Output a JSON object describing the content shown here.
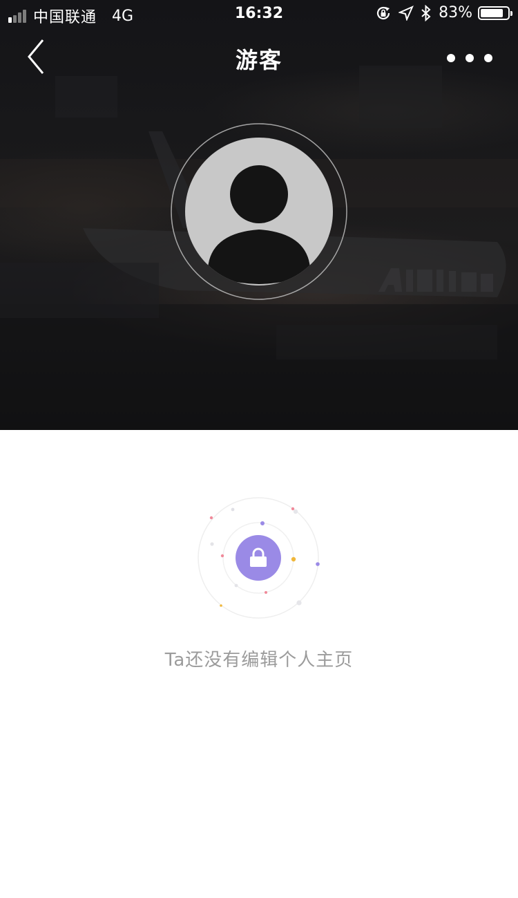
{
  "status_bar": {
    "carrier": "中国联通",
    "network": "4G",
    "time": "16:32",
    "battery_percent": "83%",
    "battery_level": 0.83,
    "signal_bars_filled": 1,
    "signal_bars_total": 4
  },
  "nav": {
    "title": "游客",
    "back_icon": "chevron-left-icon",
    "more_icon": "more-dots-icon"
  },
  "profile": {
    "avatar_icon": "default-user-icon"
  },
  "empty_state": {
    "icon": "lock-icon",
    "message": "Ta还没有编辑个人主页",
    "accent_color": "#9a8ae6"
  },
  "colors": {
    "hero_background": "#151516",
    "page_background": "#ffffff",
    "empty_text": "#9b9b9b",
    "avatar_fill": "#c8c8c8"
  }
}
